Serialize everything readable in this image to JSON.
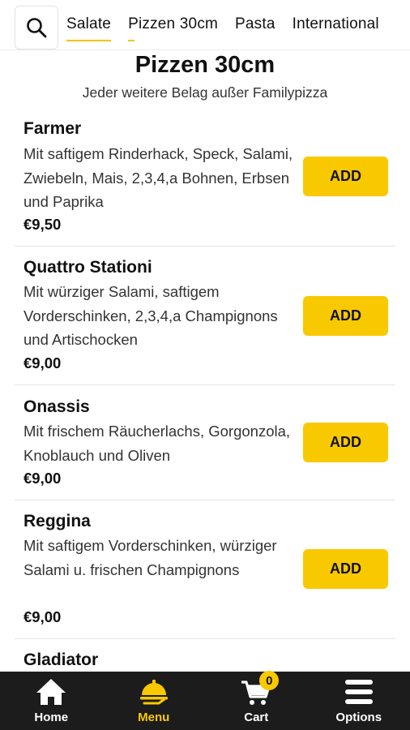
{
  "tabs": [
    "Salate",
    "Pizzen 30cm",
    "Pasta",
    "International"
  ],
  "section": {
    "title": "Pizzen 30cm",
    "subtitle": "Jeder weitere Belag außer Familypizza"
  },
  "items": [
    {
      "name": "Farmer",
      "description": "Mit saftigem Rinderhack, Speck, Salami, Zwiebeln, Mais, 2,3,4,a Bohnen, Erbsen und Paprika",
      "price": "€9,50",
      "button": "ADD"
    },
    {
      "name": "Quattro Stationi",
      "description": "Mit würziger Salami, saftigem Vorderschinken, 2,3,4,a Champignons und Artischocken",
      "price": "€9,00",
      "button": "ADD"
    },
    {
      "name": "Onassis",
      "description": "Mit frischem Räucherlachs, Gorgonzola, Knoblauch und Oliven",
      "price": "€9,00",
      "button": "ADD"
    },
    {
      "name": "Reggina",
      "description": "Mit saftigem Vorderschinken, würziger Salami u. frischen Champignons",
      "price": "€9,00",
      "button": "ADD"
    },
    {
      "name": "Gladiator",
      "description": "",
      "price": "",
      "button": ""
    }
  ],
  "bottom_nav": {
    "home": "Home",
    "menu": "Menu",
    "cart": "Cart",
    "cart_count": "0",
    "options": "Options"
  },
  "colors": {
    "accent": "#f9c900",
    "nav_background": "#1c1c1c"
  },
  "icons": [
    "search-icon",
    "home-icon",
    "menu-icon",
    "cart-icon",
    "options-icon"
  ]
}
